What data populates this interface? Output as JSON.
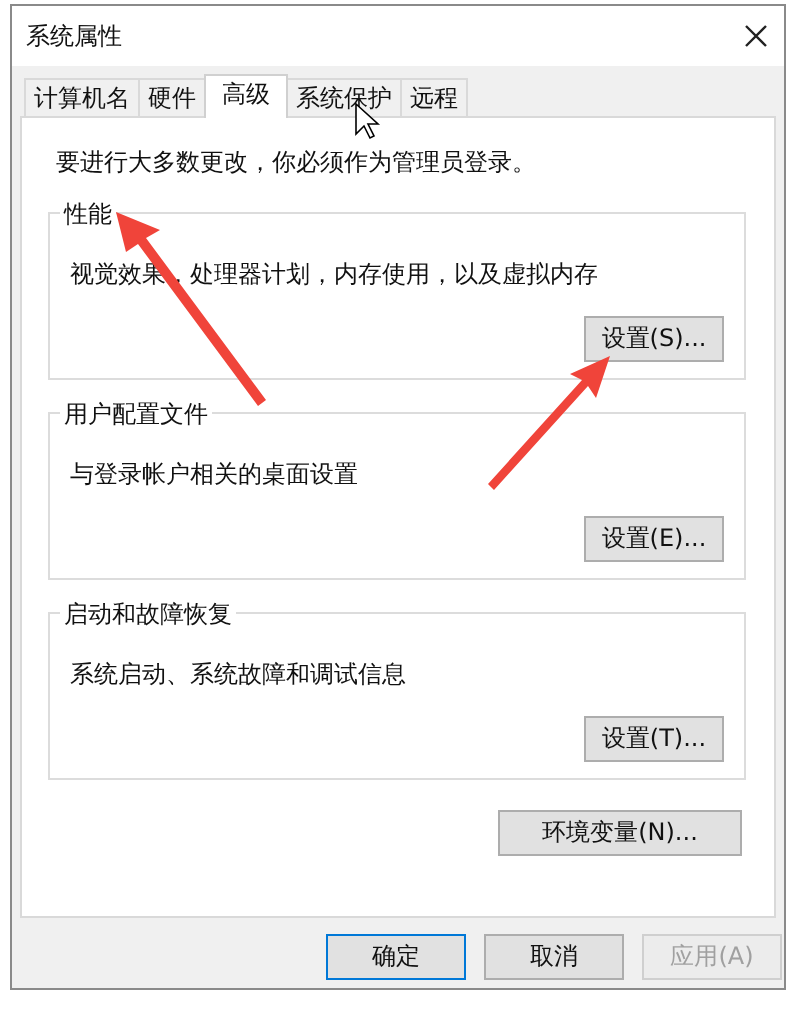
{
  "window": {
    "title": "系统属性"
  },
  "tabs": [
    {
      "label": "计算机名",
      "selected": false
    },
    {
      "label": "硬件",
      "selected": false
    },
    {
      "label": "高级",
      "selected": true
    },
    {
      "label": "系统保护",
      "selected": false
    },
    {
      "label": "远程",
      "selected": false
    }
  ],
  "notice": "要进行大多数更改，你必须作为管理员登录。",
  "groups": [
    {
      "title": "性能",
      "description": "视觉效果，处理器计划，内存使用，以及虚拟内存",
      "button": "设置(S)..."
    },
    {
      "title": "用户配置文件",
      "description": "与登录帐户相关的桌面设置",
      "button": "设置(E)..."
    },
    {
      "title": "启动和故障恢复",
      "description": "系统启动、系统故障和调试信息",
      "button": "设置(T)..."
    }
  ],
  "env_button": "环境变量(N)...",
  "buttons": [
    {
      "label": "确定",
      "kind": "default",
      "disabled": false
    },
    {
      "label": "取消",
      "kind": "normal",
      "disabled": false
    },
    {
      "label": "应用(A)",
      "kind": "normal",
      "disabled": true
    }
  ]
}
